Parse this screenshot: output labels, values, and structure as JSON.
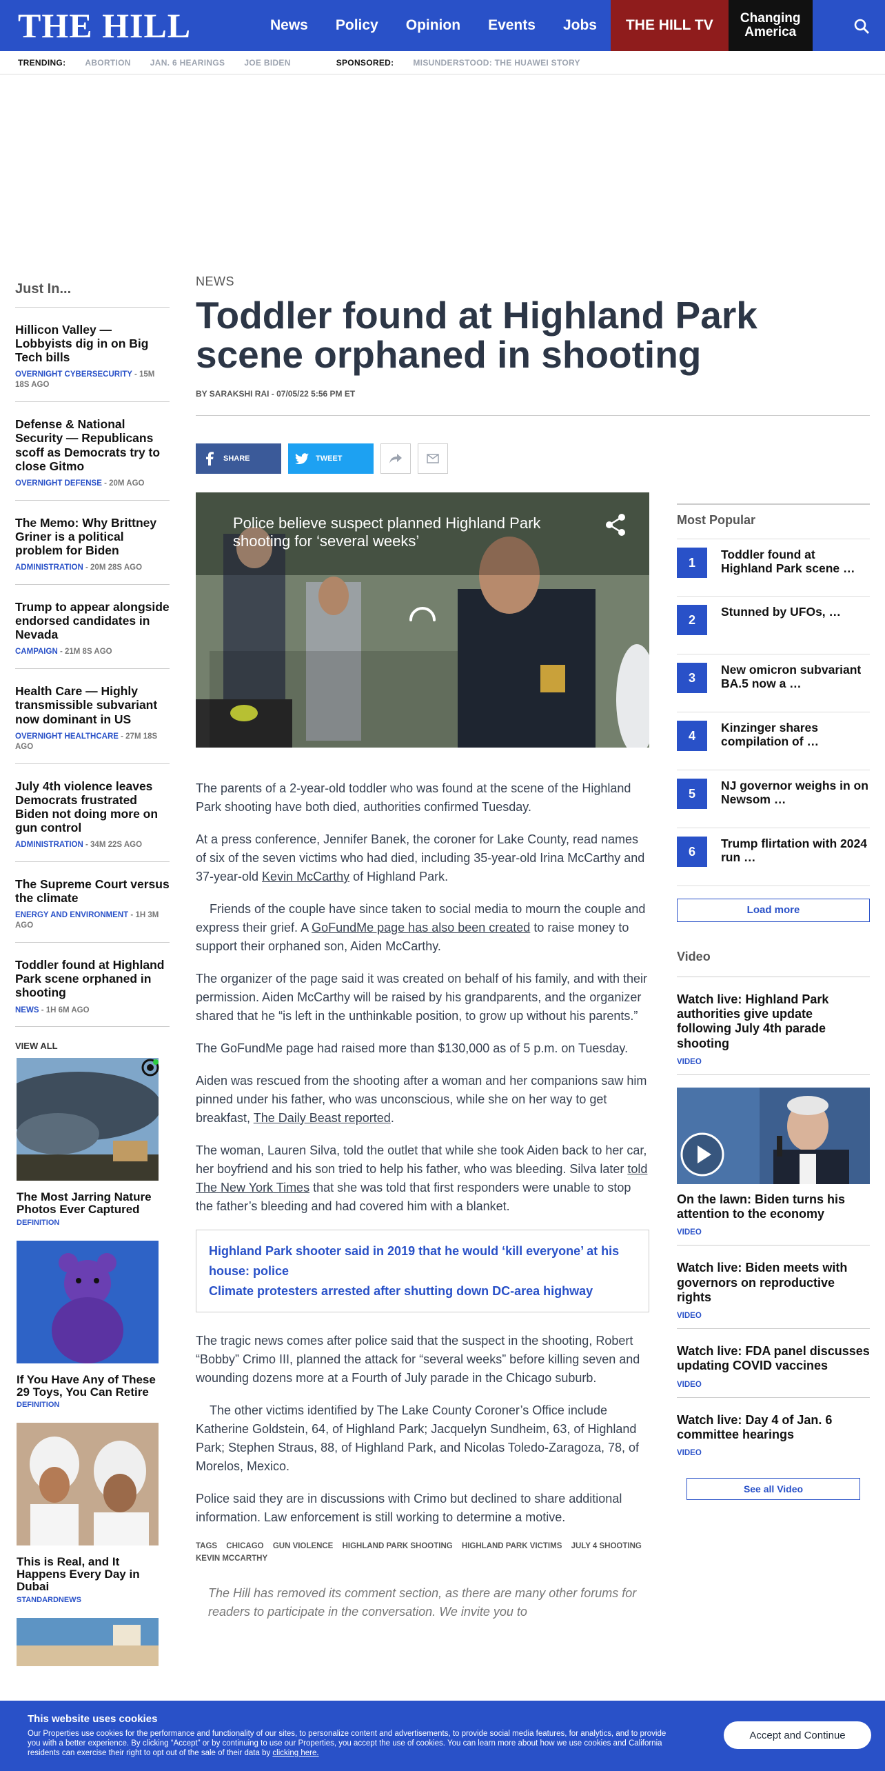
{
  "header": {
    "logo": "THE HILL",
    "nav": [
      "News",
      "Policy",
      "Opinion",
      "Events",
      "Jobs"
    ],
    "tv": "THE HILL TV",
    "changing": "Changing America"
  },
  "trending": {
    "label": "TRENDING:",
    "links": [
      "ABORTION",
      "JAN. 6 HEARINGS",
      "JOE BIDEN"
    ],
    "sponsored_label": "SPONSORED:",
    "sponsored_link": "MISUNDERSTOOD: THE HUAWEI STORY"
  },
  "just_in": {
    "title": "Just In...",
    "items": [
      {
        "title": "Hillicon Valley — Lobbyists dig in on Big Tech bills",
        "category": "OVERNIGHT CYBERSECURITY",
        "time": "- 15M 18S AGO"
      },
      {
        "title": "Defense & National Security — Republicans scoff as Democrats try to close Gitmo",
        "category": "OVERNIGHT DEFENSE",
        "time": "- 20M AGO"
      },
      {
        "title": "The Memo: Why Brittney Griner is a political problem for Biden",
        "category": "ADMINISTRATION",
        "time": "- 20M 28S AGO"
      },
      {
        "title": "Trump to appear alongside endorsed candidates in Nevada",
        "category": "CAMPAIGN",
        "time": "- 21M 8S AGO"
      },
      {
        "title": "Health Care — Highly transmissible subvariant now dominant in US",
        "category": "OVERNIGHT HEALTHCARE",
        "time": "- 27M 18S AGO"
      },
      {
        "title": "July 4th violence leaves Democrats frustrated Biden not doing more on gun control",
        "category": "ADMINISTRATION",
        "time": "- 34M 22S AGO"
      },
      {
        "title": "The Supreme Court versus the climate",
        "category": "ENERGY AND ENVIRONMENT",
        "time": "- 1H 3M AGO"
      },
      {
        "title": "Toddler found at Highland Park scene orphaned in shooting",
        "category": "NEWS",
        "time": "- 1H 6M AGO"
      }
    ],
    "view_all": "VIEW ALL"
  },
  "ads": [
    {
      "title": "The Most Jarring Nature Photos Ever Captured",
      "source": "DEFINITION"
    },
    {
      "title": "If You Have Any of These 29 Toys, You Can Retire",
      "source": "DEFINITION"
    },
    {
      "title": "This is Real, and It Happens Every Day in Dubai",
      "source": "STANDARDNEWS"
    }
  ],
  "article": {
    "kicker": "NEWS",
    "headline": "Toddler found at Highland Park scene orphaned in shooting",
    "byline": "BY SARAKSHI RAI - 07/05/22 5:56 PM ET",
    "share_label": "SHARE",
    "tweet_label": "TWEET",
    "video_title": "Police believe suspect planned Highland Park shooting for ‘several weeks’",
    "p1": "The parents of a 2-year-old toddler who was found at the scene of the Highland Park shooting have both died, authorities confirmed Tuesday.",
    "p2a": "At a press conference, Jennifer Banek, the coroner for Lake County, read names of six of the seven victims who had died, including 35-year-old Irina McCarthy and 37-year-old ",
    "p2link": "Kevin McCarthy",
    "p2b": " of Highland Park.",
    "p3a": "Friends of the couple have since taken to social media to mourn the couple and express their grief. A ",
    "p3link": "GoFundMe page has also been created",
    "p3b": " to raise money to support their orphaned son, Aiden McCarthy.",
    "p4": "The organizer of the page said it was created on behalf of his family, and with their permission. Aiden McCarthy will be raised by his grandparents, and the organizer shared that he “is left in the unthinkable position, to grow up without his parents.”",
    "p5": "The GoFundMe page had raised more than $130,000 as of 5 p.m. on Tuesday.",
    "p6a": "Aiden was rescued from the shooting after a woman and her companions saw him pinned under his father, who was unconscious, while she on her way to get breakfast, ",
    "p6link": "The Daily Beast reported",
    "p6b": ".",
    "p7a": "The woman, Lauren Silva, told the outlet that while she took Aiden back to her car, her boyfriend and his son tried to help his father, who was bleeding. Silva later ",
    "p7link": "told The New York Times",
    "p7b": " that she was told that first responders were unable to stop the father’s bleeding and had covered him with a blanket.",
    "related": [
      "Highland Park shooter said in 2019 that he would ‘kill everyone’ at his house: police",
      "Climate protesters arrested after shutting down DC-area highway"
    ],
    "p8": "The tragic news comes after police said that the suspect in the shooting, Robert “Bobby” Crimo III, planned the attack for “several weeks” before killing seven and wounding dozens more at a Fourth of July parade in the Chicago suburb.",
    "p9": "The other victims identified by The Lake County Coroner’s Office include Katherine Goldstein, 64, of Highland Park; Jacquelyn Sundheim, 63, of Highland Park; Stephen Straus, 88, of Highland Park, and Nicolas Toledo-Zaragoza, 78, of Morelos, Mexico.",
    "p10": "Police said they are in discussions with Crimo but declined to share additional information. Law enforcement is still working to determine a motive.",
    "tags_label": "TAGS",
    "tags": [
      "CHICAGO",
      "GUN VIOLENCE",
      "HIGHLAND PARK SHOOTING",
      "HIGHLAND PARK VICTIMS",
      "JULY 4 SHOOTING",
      "KEVIN MCCARTHY"
    ],
    "comment_note": "The Hill has removed its comment section, as there are many other forums for readers to participate in the conversation. We invite you to"
  },
  "most_popular": {
    "title": "Most Popular",
    "items": [
      {
        "n": "1",
        "title": "Toddler found at Highland Park scene …"
      },
      {
        "n": "2",
        "title": "Stunned by UFOs, …"
      },
      {
        "n": "3",
        "title": "New omicron subvariant BA.5 now a …"
      },
      {
        "n": "4",
        "title": "Kinzinger shares compilation of …"
      },
      {
        "n": "5",
        "title": "NJ governor weighs in on Newsom …"
      },
      {
        "n": "6",
        "title": "Trump flirtation with 2024 run …"
      }
    ],
    "load_more": "Load more"
  },
  "video": {
    "title": "Video",
    "items": [
      {
        "title": "Watch live: Highland Park authorities give update following July 4th parade shooting",
        "label": "VIDEO"
      },
      {
        "title": "On the lawn: Biden turns his attention to the economy",
        "label": "VIDEO"
      },
      {
        "title": "Watch live: Biden meets with governors on reproductive rights",
        "label": "VIDEO"
      },
      {
        "title": "Watch live: FDA panel discusses updating COVID vaccines",
        "label": "VIDEO"
      },
      {
        "title": "Watch live: Day 4 of Jan. 6 committee hearings",
        "label": "VIDEO"
      }
    ],
    "see_all": "See all Video"
  },
  "cookie": {
    "title": "This website uses cookies",
    "text": "Our Properties use cookies for the performance and functionality of our sites, to personalize content and advertisements, to provide social media features, for analytics, and to provide you with a better experience. By clicking “Accept” or by continuing to use our Properties, you accept the use of cookies. You can learn more about how we use cookies and California residents can exercise their right to opt out of the sale of their data by ",
    "link": "clicking here.",
    "accept": "Accept and Continue"
  }
}
